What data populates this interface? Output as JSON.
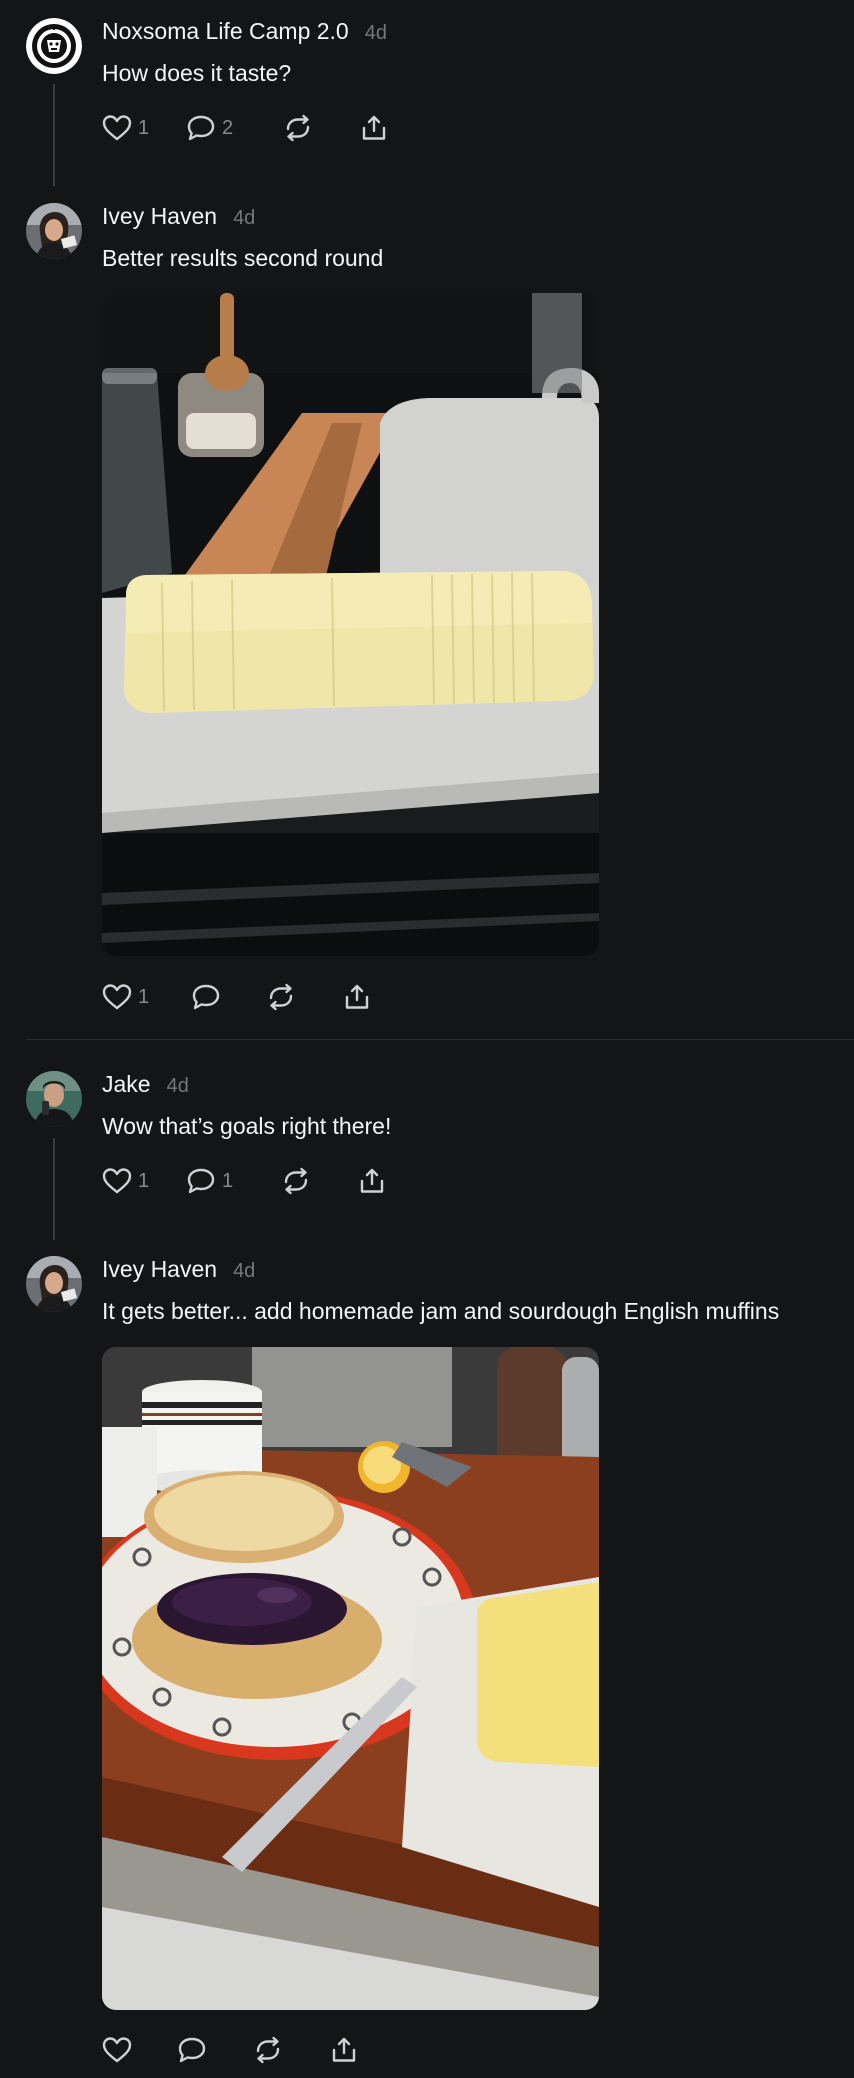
{
  "posts": [
    {
      "username": "Noxsoma Life Camp 2.0",
      "time": "4d",
      "text": "How does it taste?",
      "likes": "1",
      "replies": "2",
      "avatar_icon": "noxsoma-logo"
    },
    {
      "username": "Ivey Haven",
      "time": "4d",
      "text": "Better results second round",
      "likes": "1",
      "replies": "",
      "image_icon": "butter-roll-photo"
    },
    {
      "username": "Jake",
      "time": "4d",
      "text": "Wow that’s goals right there!",
      "likes": "1",
      "replies": "1"
    },
    {
      "username": "Ivey Haven",
      "time": "4d",
      "text": "It gets better... add homemade jam and sourdough English muffins",
      "likes": "",
      "replies": "",
      "image_icon": "jam-muffins-photo"
    }
  ],
  "icons": {
    "like": "heart-icon",
    "reply": "comment-icon",
    "repost": "repost-icon",
    "share": "share-icon"
  },
  "colors": {
    "background": "#141517",
    "text_primary": "#f3f5f7",
    "text_secondary": "#777777",
    "icon": "#cfd1d4"
  }
}
